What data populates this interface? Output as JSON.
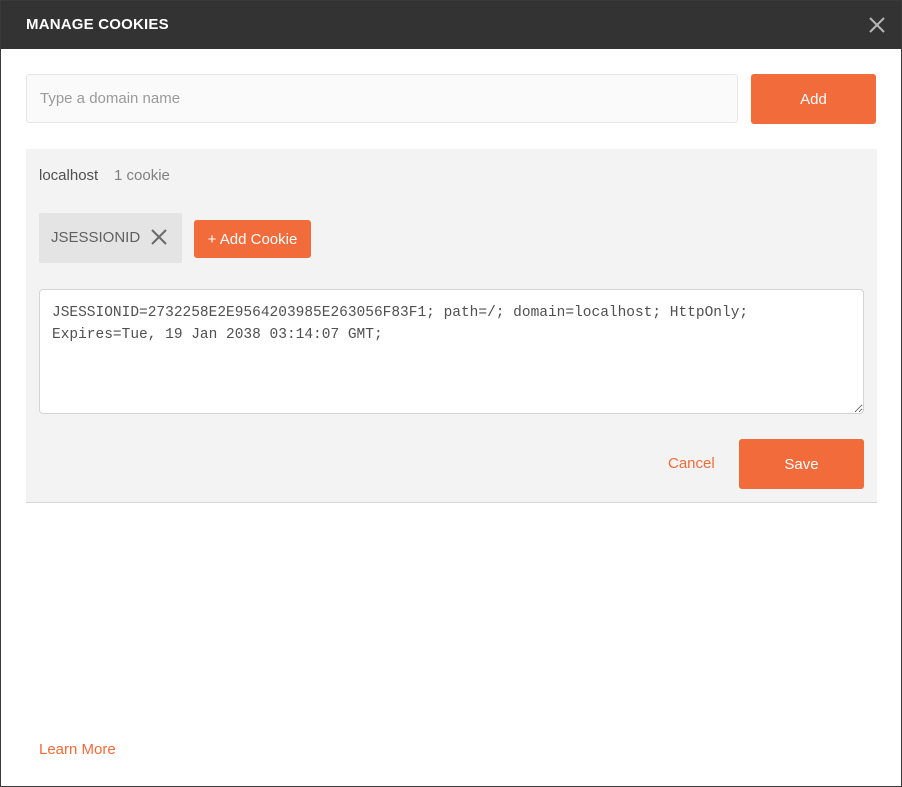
{
  "dialog": {
    "title": "MANAGE COOKIES",
    "close_icon": "close-icon"
  },
  "domain_form": {
    "placeholder": "Type a domain name",
    "value": "",
    "add_label": "Add"
  },
  "domain_panel": {
    "domain": "localhost",
    "count_label": "1 cookie",
    "cookies": [
      {
        "name": "JSESSIONID",
        "remove_icon": "close-icon"
      }
    ],
    "add_cookie_label": "+ Add Cookie",
    "editor_value": "JSESSIONID=2732258E2E9564203985E263056F83F1; path=/; domain=localhost; HttpOnly; Expires=Tue, 19 Jan 2038 03:14:07 GMT;",
    "cancel_label": "Cancel",
    "save_label": "Save"
  },
  "footer": {
    "learn_more_label": "Learn More"
  },
  "colors": {
    "header_bg": "#333333",
    "accent": "#f26b3a",
    "panel_bg": "#f3f3f3"
  }
}
